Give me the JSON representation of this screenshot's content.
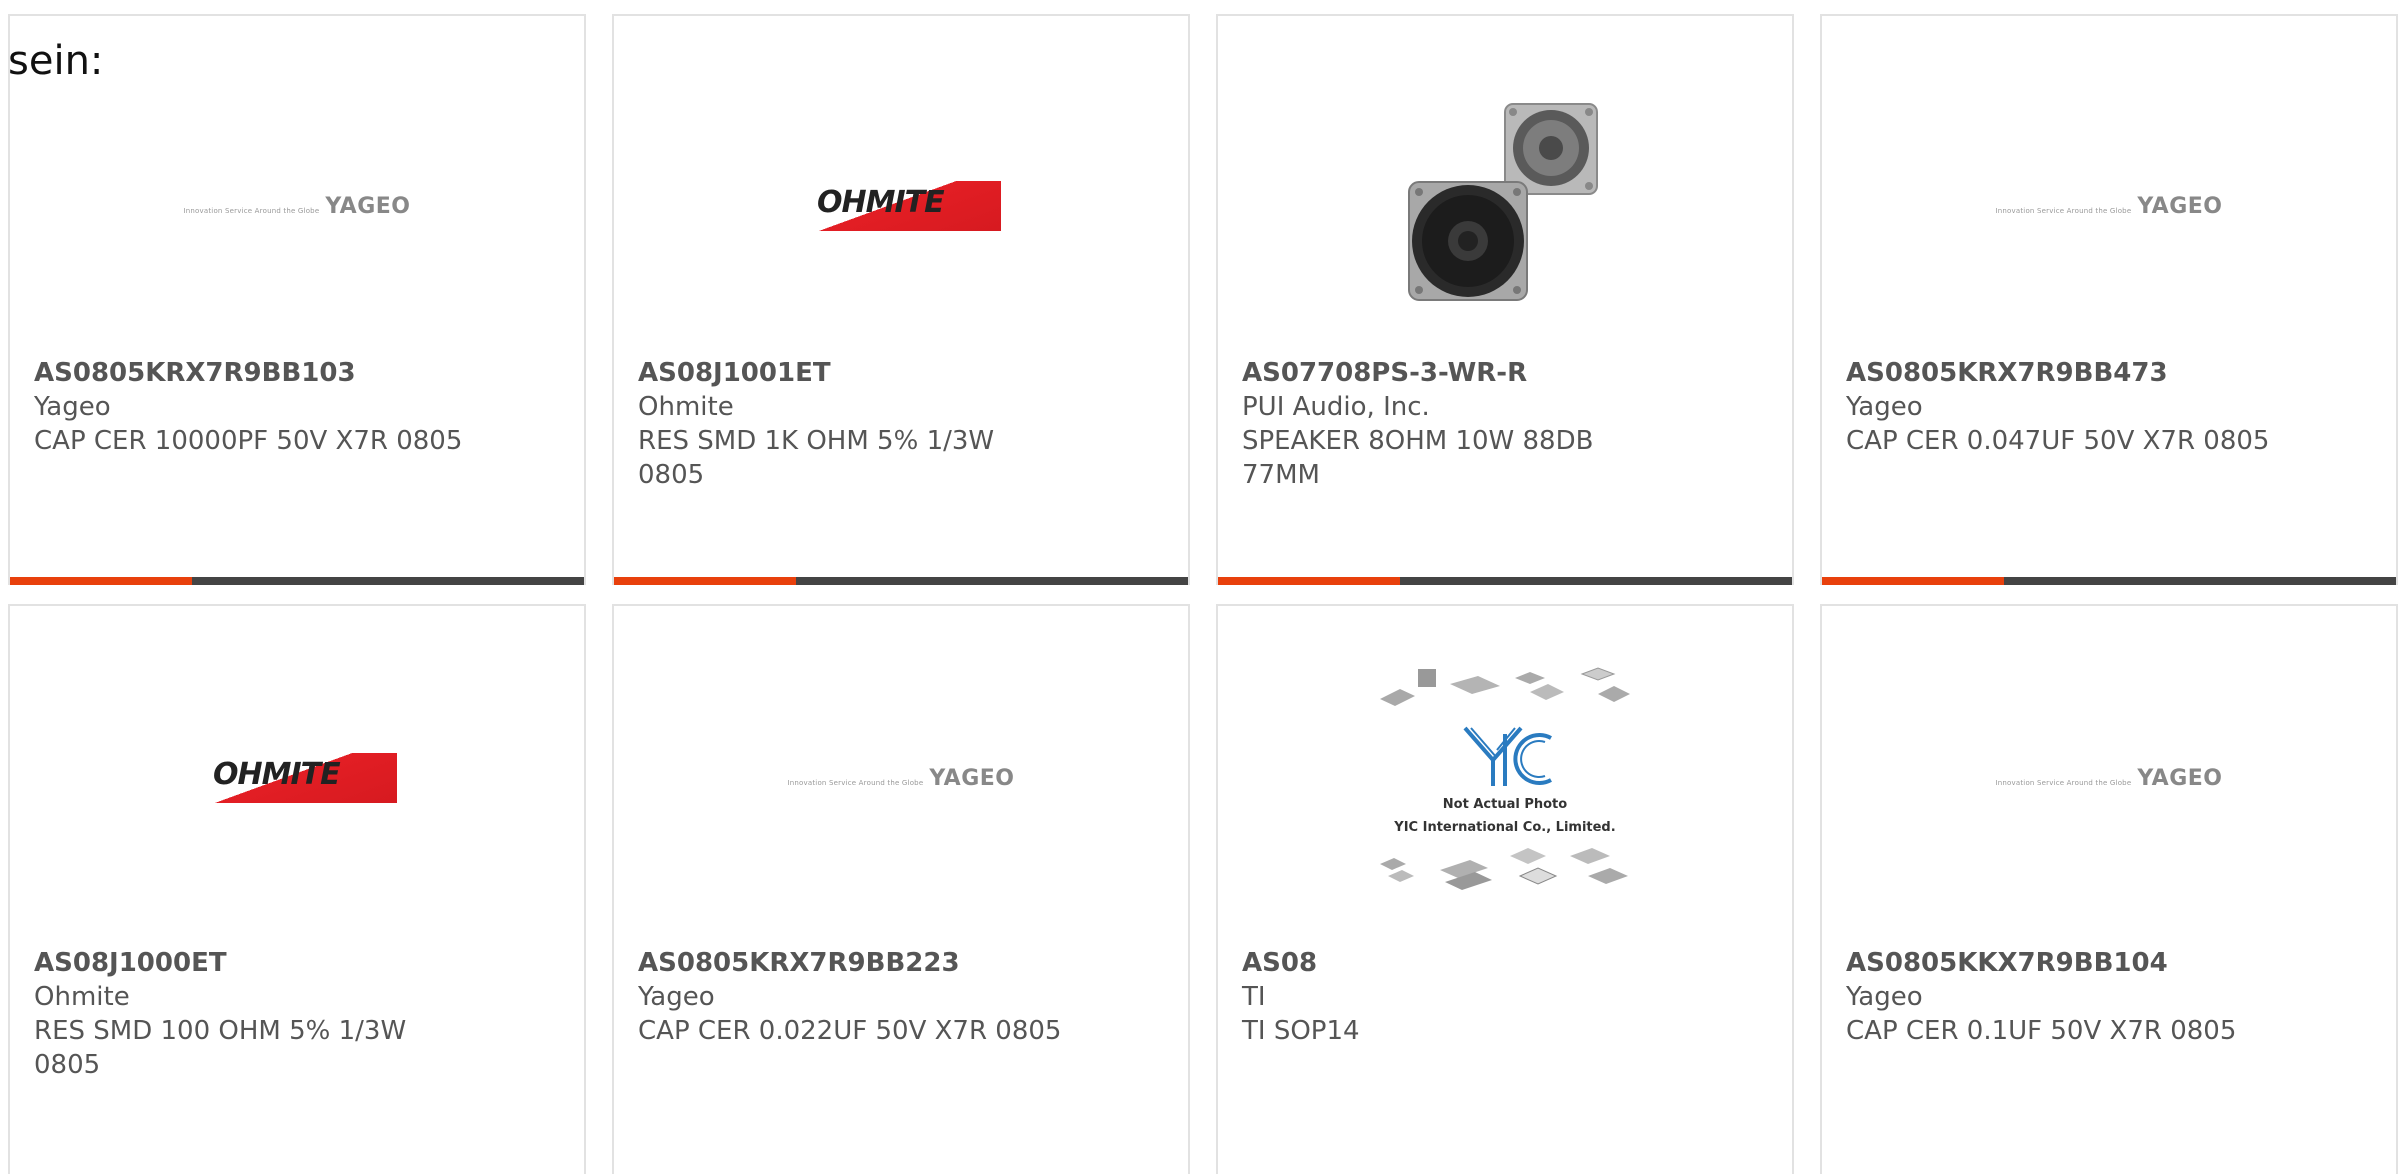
{
  "intro_text": "sein:",
  "products": [
    {
      "part": "AS0805KRX7R9BB103",
      "manufacturer": "Yageo",
      "description": "CAP CER 10000PF 50V X7R 0805",
      "image": "yageo-logo"
    },
    {
      "part": "AS08J1001ET",
      "manufacturer": "Ohmite",
      "description": "RES SMD 1K OHM 5% 1/3W 0805",
      "image": "ohmite-logo"
    },
    {
      "part": "AS07708PS-3-WR-R",
      "manufacturer": "PUI Audio, Inc.",
      "description": "SPEAKER 8OHM 10W 88DB 77MM",
      "image": "speaker-photo"
    },
    {
      "part": "AS0805KRX7R9BB473",
      "manufacturer": "Yageo",
      "description": "CAP CER 0.047UF 50V X7R 0805",
      "image": "yageo-logo"
    },
    {
      "part": "AS08J1000ET",
      "manufacturer": "Ohmite",
      "description": "RES SMD 100 OHM 5% 1/3W 0805",
      "image": "ohmite-logo"
    },
    {
      "part": "AS0805KRX7R9BB223",
      "manufacturer": "Yageo",
      "description": "CAP CER 0.022UF 50V X7R 0805",
      "image": "yageo-logo"
    },
    {
      "part": "AS08",
      "manufacturer": "TI",
      "description": "TI SOP14",
      "image": "yic-placeholder"
    },
    {
      "part": "AS0805KKX7R9BB104",
      "manufacturer": "Yageo",
      "description": "CAP CER 0.1UF 50V X7R 0805",
      "image": "yageo-logo"
    }
  ],
  "logos": {
    "yageo_word": "YAGEO",
    "yageo_tagline": "Innovation Service Around the Globe",
    "ohmite_word": "OHMITE",
    "yic_line1": "Not Actual Photo",
    "yic_line2": "YIC International Co., Limited."
  },
  "colors": {
    "accent": "#e8400c",
    "bar": "#444444",
    "border": "#e2e2e2",
    "text": "#555555",
    "ohmite_red": "#e31e24"
  }
}
